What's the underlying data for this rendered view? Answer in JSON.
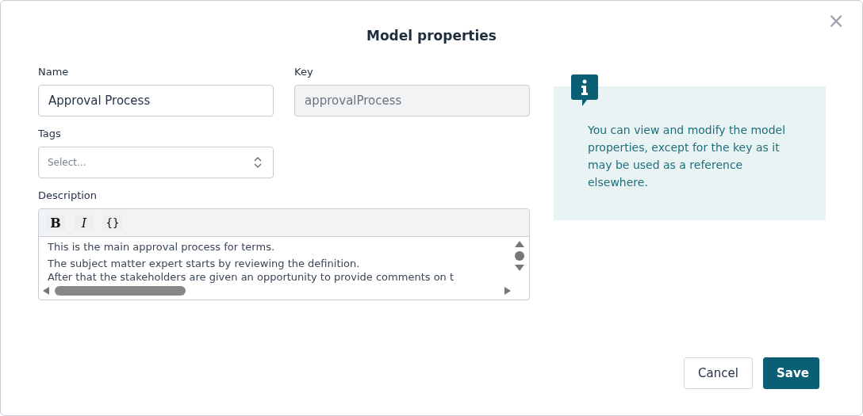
{
  "dialog": {
    "title": "Model properties",
    "close": "×"
  },
  "fields": [
    {
      "label": "Name",
      "value": "Approval Process",
      "disabled": false
    },
    {
      "label": "Key",
      "value": "approvalProcess",
      "disabled": true
    }
  ],
  "tags": {
    "label": "Tags",
    "placeholder": "Select..."
  },
  "description": {
    "label": "Description",
    "toolbar": [
      "B",
      "I",
      "{}"
    ],
    "lines": [
      "This is the main approval process for terms.",
      "The subject matter expert starts by reviewing the definition.",
      "After that the stakeholders are given an opportunity to provide comments on t"
    ]
  },
  "info": {
    "text": "You can view and modify the model properties, except for the key as it may be used as a reference elsewhere."
  },
  "buttons": [
    {
      "label": "Cancel",
      "kind": "secondary"
    },
    {
      "label": "Save",
      "kind": "primary"
    }
  ]
}
